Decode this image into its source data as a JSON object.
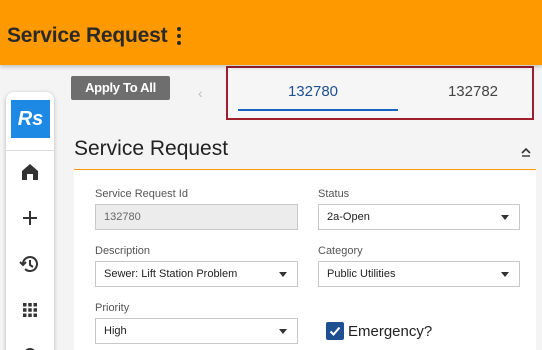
{
  "header": {
    "title": "Service Request",
    "menu_icon": "kebab-menu-icon"
  },
  "sidebar": {
    "logo": "Rs",
    "items": [
      {
        "icon": "home-icon"
      },
      {
        "icon": "plus-icon"
      },
      {
        "icon": "history-icon"
      },
      {
        "icon": "apps-grid-icon"
      },
      {
        "icon": "gear-icon"
      }
    ]
  },
  "toolbar": {
    "apply_all_label": "Apply To All"
  },
  "tabs": [
    {
      "label": "132780",
      "active": true
    },
    {
      "label": "132782",
      "active": false
    }
  ],
  "section": {
    "title": "Service Request"
  },
  "form": {
    "sr_id": {
      "label": "Service Request Id",
      "value": "132780"
    },
    "status": {
      "label": "Status",
      "value": "2a-Open"
    },
    "description": {
      "label": "Description",
      "value": "Sewer: Lift Station Problem"
    },
    "category": {
      "label": "Category",
      "value": "Public Utilities"
    },
    "priority": {
      "label": "Priority",
      "value": "High"
    },
    "emergency": {
      "label": "Emergency?",
      "checked": true
    }
  },
  "colors": {
    "brand": "#ff9900",
    "accent": "#1d4f91",
    "logo_bg": "#1e88e5"
  }
}
